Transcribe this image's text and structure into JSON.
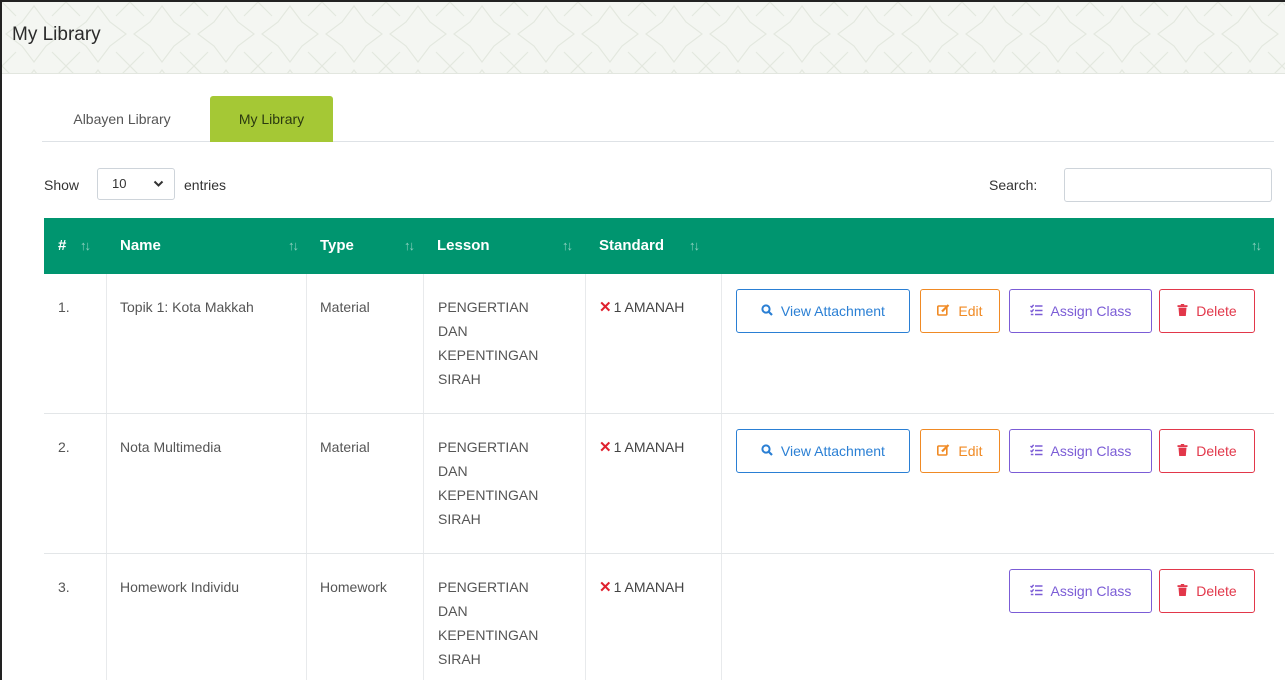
{
  "page": {
    "title": "My Library"
  },
  "tabs": [
    {
      "label": "Albayen Library",
      "active": false
    },
    {
      "label": "My Library",
      "active": true
    }
  ],
  "length_menu": {
    "show_label": "Show",
    "selected": "10",
    "entries_label": "entries"
  },
  "search": {
    "label": "Search:",
    "value": ""
  },
  "table": {
    "columns": [
      "#",
      "Name",
      "Type",
      "Lesson",
      "Standard",
      ""
    ],
    "sort_glyph": "↑↓",
    "rows": [
      {
        "num": "1.",
        "name": "Topik 1: Kota Makkah",
        "type": "Material",
        "lesson": [
          "PENGERTIAN",
          "DAN",
          "KEPENTINGAN",
          "SIRAH"
        ],
        "standard": "1 AMANAH"
      },
      {
        "num": "2.",
        "name": "Nota Multimedia",
        "type": "Material",
        "lesson": [
          "PENGERTIAN",
          "DAN",
          "KEPENTINGAN",
          "SIRAH"
        ],
        "standard": "1 AMANAH"
      },
      {
        "num": "3.",
        "name": "Homework Individu",
        "type": "Homework",
        "lesson": [
          "PENGERTIAN",
          "DAN",
          "KEPENTINGAN",
          "SIRAH"
        ],
        "standard": "1 AMANAH"
      }
    ]
  },
  "actions": {
    "view_attachment": "View Attachment",
    "edit": "Edit",
    "assign_class": "Assign Class",
    "delete": "Delete"
  },
  "icons": {
    "view": "search-icon",
    "edit": "edit-icon",
    "assign": "list-check-icon",
    "delete": "trash-icon",
    "standard_status": "x-mark-icon"
  },
  "colors": {
    "table_header": "#00956f",
    "active_tab": "#a5c835",
    "view": "#2a7fd4",
    "edit": "#f08a24",
    "assign": "#7b5cd6",
    "delete": "#e2374a",
    "x_mark": "#e0212e"
  }
}
